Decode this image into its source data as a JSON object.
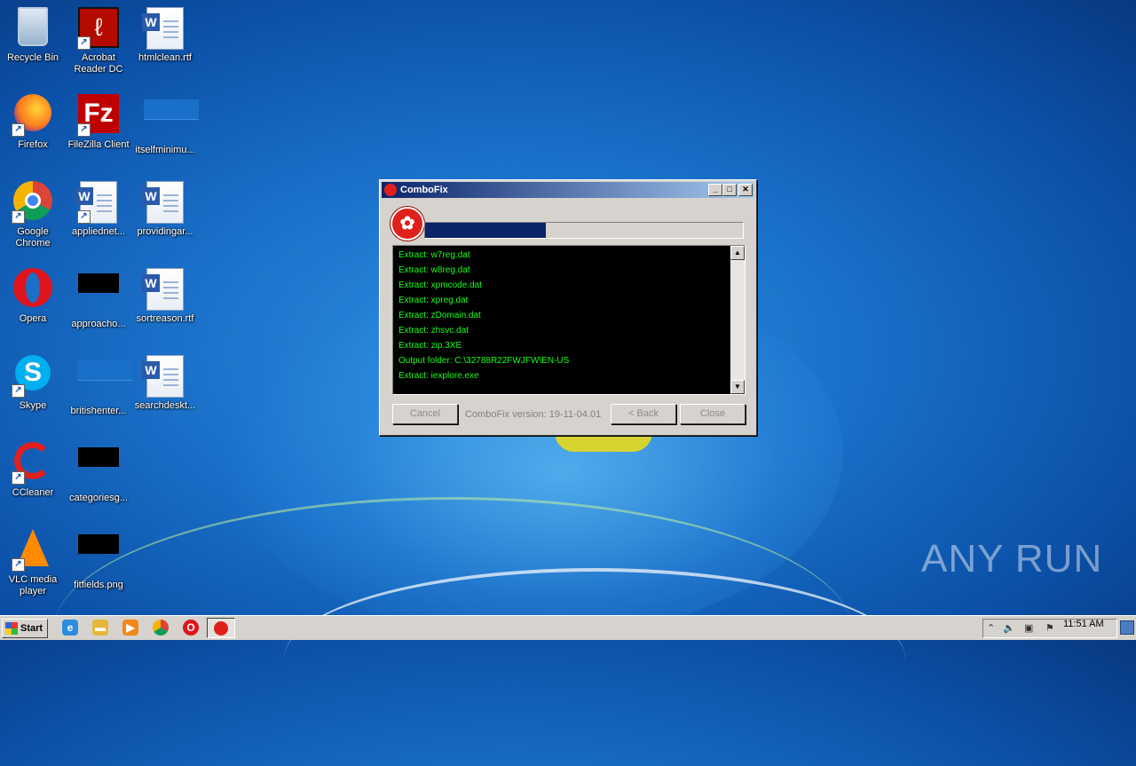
{
  "desktop": {
    "icons": [
      {
        "label": "Recycle Bin",
        "icon": "recycle-bin-icon"
      },
      {
        "label": "Acrobat Reader DC",
        "icon": "acrobat-icon"
      },
      {
        "label": "htmlclean.rtf",
        "icon": "word-doc-icon"
      },
      {
        "label": "Firefox",
        "icon": "firefox-icon"
      },
      {
        "label": "FileZilla Client",
        "icon": "filezilla-icon"
      },
      {
        "label": "itselfminimu...",
        "icon": "blank-file-icon"
      },
      {
        "label": "Google Chrome",
        "icon": "chrome-icon"
      },
      {
        "label": "appliednet...",
        "icon": "word-doc-icon"
      },
      {
        "label": "providingar...",
        "icon": "word-doc-icon"
      },
      {
        "label": "Opera",
        "icon": "opera-icon"
      },
      {
        "label": "approacho...",
        "icon": "black-image-icon"
      },
      {
        "label": "sortreason.rtf",
        "icon": "word-doc-icon"
      },
      {
        "label": "Skype",
        "icon": "skype-icon"
      },
      {
        "label": "britishenter...",
        "icon": "blank-file-icon"
      },
      {
        "label": "searchdeskt...",
        "icon": "word-doc-icon"
      },
      {
        "label": "CCleaner",
        "icon": "ccleaner-icon"
      },
      {
        "label": "categoriesg...",
        "icon": "black-image-icon"
      },
      {
        "label": "VLC media player",
        "icon": "vlc-icon"
      },
      {
        "label": "fitfields.png",
        "icon": "black-image-icon"
      }
    ],
    "watermark": "ANY RUN"
  },
  "window": {
    "title": "ComboFix",
    "progress_fraction": 0.38,
    "log_lines": [
      "Extract: w7reg.dat",
      "Extract: w8reg.dat",
      "Extract: xpmcode.dat",
      "Extract: xpreg.dat",
      "Extract: zDomain.dat",
      "Extract: zhsvc.dat",
      "Extract: zip.3XE",
      "Output folder: C:\\32788R22FWJFW\\EN-US",
      "Extract: iexplore.exe"
    ],
    "cancel_label": "Cancel",
    "version_text": "ComboFix version: 19-11-04.01",
    "back_label": "< Back",
    "close_label": "Close"
  },
  "taskbar": {
    "start_label": "Start",
    "clock": "11:51 AM"
  }
}
